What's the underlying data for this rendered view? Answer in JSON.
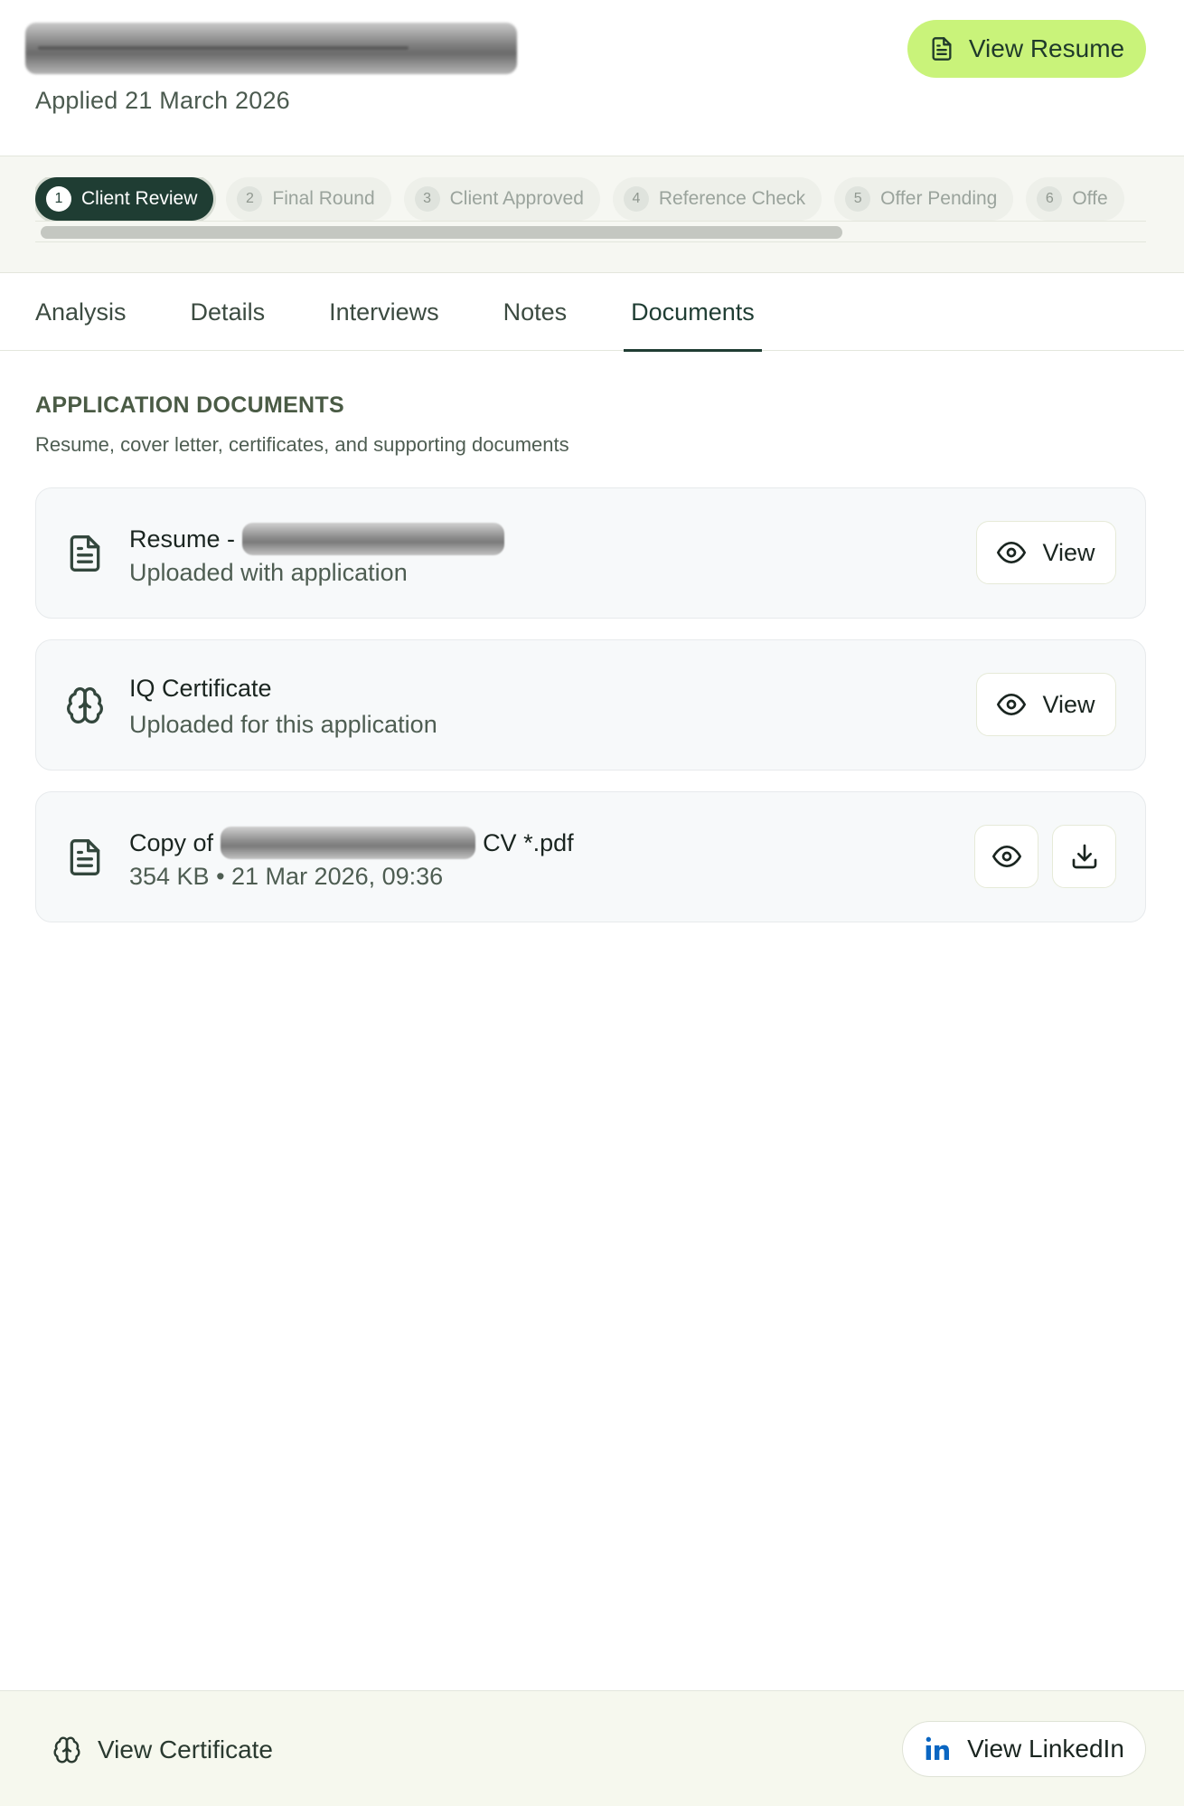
{
  "header": {
    "candidate_name": "Carol Reece-Edwards",
    "applied_text": "Applied 21 March 2026",
    "view_resume_label": "View Resume"
  },
  "pipeline": {
    "stages": [
      {
        "number": "1",
        "label": "Client Review",
        "active": true
      },
      {
        "number": "2",
        "label": "Final Round",
        "active": false
      },
      {
        "number": "3",
        "label": "Client Approved",
        "active": false
      },
      {
        "number": "4",
        "label": "Reference Check",
        "active": false
      },
      {
        "number": "5",
        "label": "Offer Pending",
        "active": false
      },
      {
        "number": "6",
        "label": "Offe",
        "active": false
      }
    ]
  },
  "tabs": [
    {
      "label": "Analysis",
      "active": false
    },
    {
      "label": "Details",
      "active": false
    },
    {
      "label": "Interviews",
      "active": false
    },
    {
      "label": "Notes",
      "active": false
    },
    {
      "label": "Documents",
      "active": true
    }
  ],
  "documents": {
    "title": "APPLICATION DOCUMENTS",
    "subtitle": "Resume, cover letter, certificates, and supporting documents",
    "items": [
      {
        "icon": "file-text-icon",
        "title_prefix": "Resume -",
        "title_redacted": "Carol Reece-Edwards",
        "subtitle": "Uploaded with application",
        "view_label": "View"
      },
      {
        "icon": "brain-icon",
        "title": "IQ Certificate",
        "subtitle": "Uploaded for this application",
        "view_label": "View"
      },
      {
        "icon": "file-text-icon",
        "title_prefix": "Copy of",
        "title_redacted": "Carol Reece-Edwards",
        "title_suffix": "CV *.pdf",
        "subtitle": "354 KB • 21 Mar 2026, 09:36"
      }
    ]
  },
  "footer": {
    "view_certificate_label": "View Certificate",
    "view_linkedin_label": "View LinkedIn"
  },
  "colors": {
    "accent_lime": "#c9f37a",
    "primary_dark_green": "#1f3d33",
    "linkedin_blue": "#0a66c2"
  }
}
